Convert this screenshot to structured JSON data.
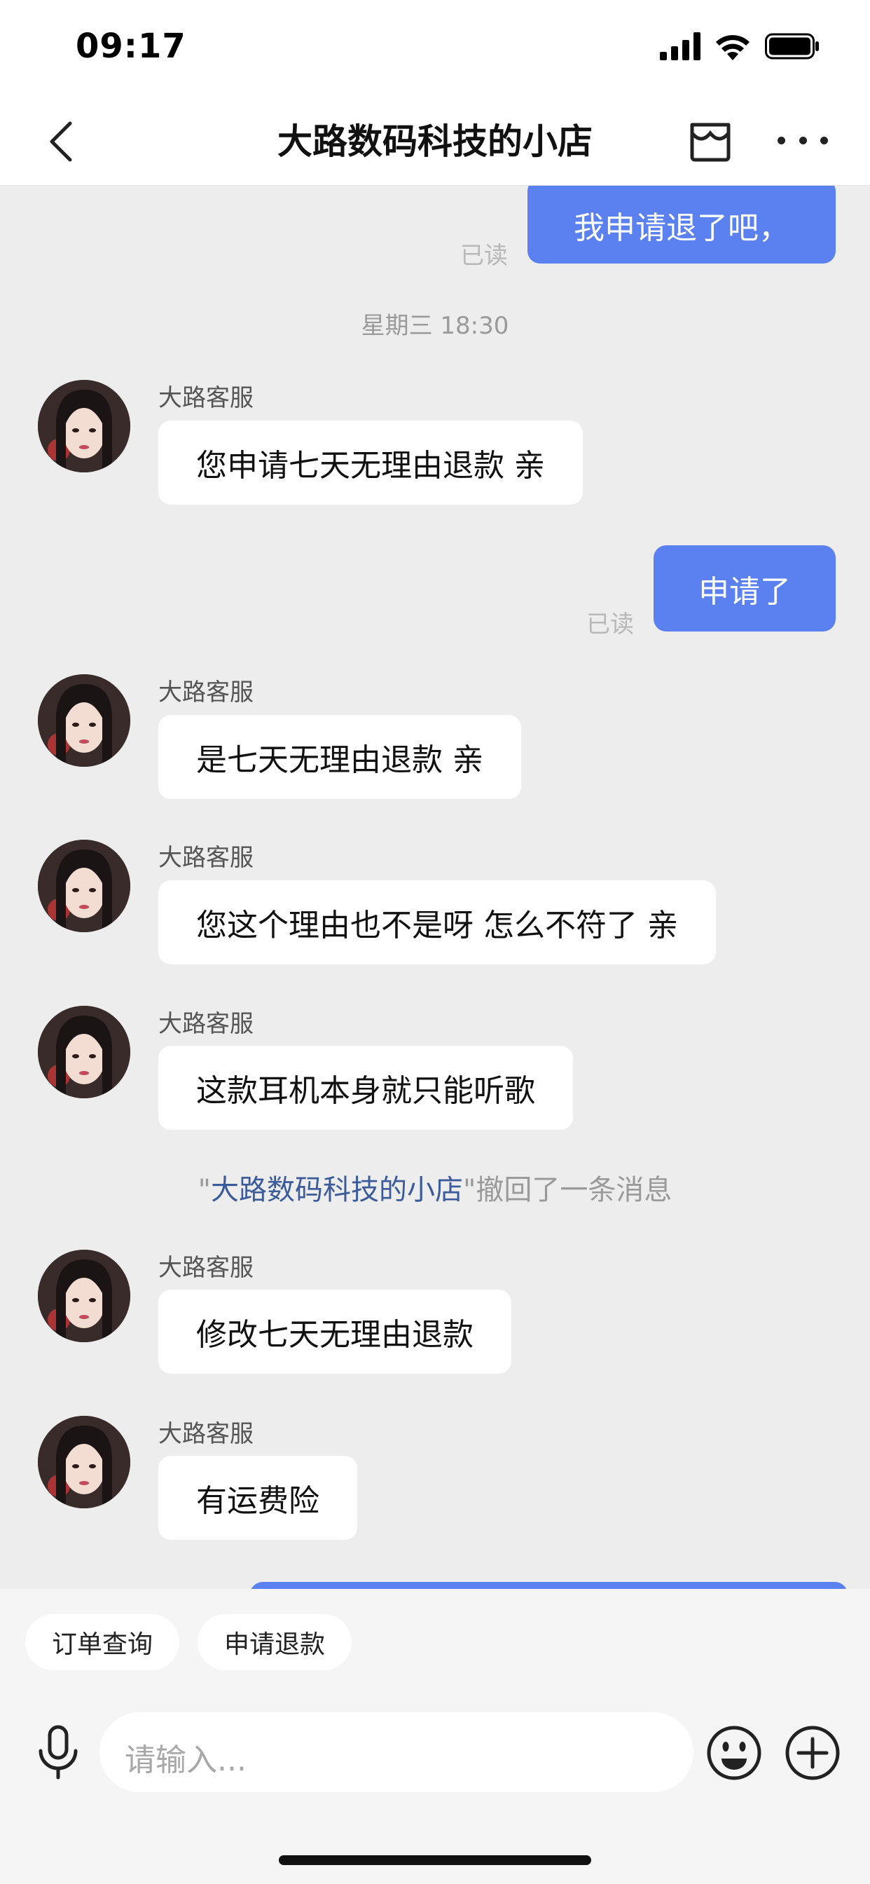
{
  "status_bar": {
    "time": "09:17"
  },
  "header": {
    "title": "大路数码科技的小店"
  },
  "chat": {
    "read_label": "已读",
    "outgoing": [
      {
        "text": "我申请退了吧，"
      },
      {
        "text": "申请了"
      }
    ],
    "timestamp": "星期三 18:30",
    "incoming": [
      {
        "sender": "大路客服",
        "text": "您申请七天无理由退款 亲"
      },
      {
        "sender": "大路客服",
        "text": "是七天无理由退款 亲"
      },
      {
        "sender": "大路客服",
        "text": "您这个理由也不是呀 怎么不符了 亲"
      },
      {
        "sender": "大路客服",
        "text": "这款耳机本身就只能听歌"
      },
      {
        "sender": "大路客服",
        "text": "修改七天无理由退款"
      },
      {
        "sender": "大路客服",
        "text": "有运费险"
      }
    ],
    "recall": {
      "quote_open": "\"",
      "shop_name": "大路数码科技的小店",
      "quote_close": "\"",
      "message": "撤回了一条消息"
    }
  },
  "quick_actions": [
    {
      "label": "订单查询"
    },
    {
      "label": "申请退款"
    }
  ],
  "input": {
    "placeholder": "请输入..."
  },
  "colors": {
    "accent_bubble": "#5b80f0",
    "chat_background": "#ededed",
    "shop_link": "#3b5b9a"
  },
  "icons": [
    "back-icon",
    "store-icon",
    "more-icon",
    "microphone-icon",
    "emoji-icon",
    "plus-icon",
    "signal-icon",
    "wifi-icon",
    "battery-icon"
  ]
}
